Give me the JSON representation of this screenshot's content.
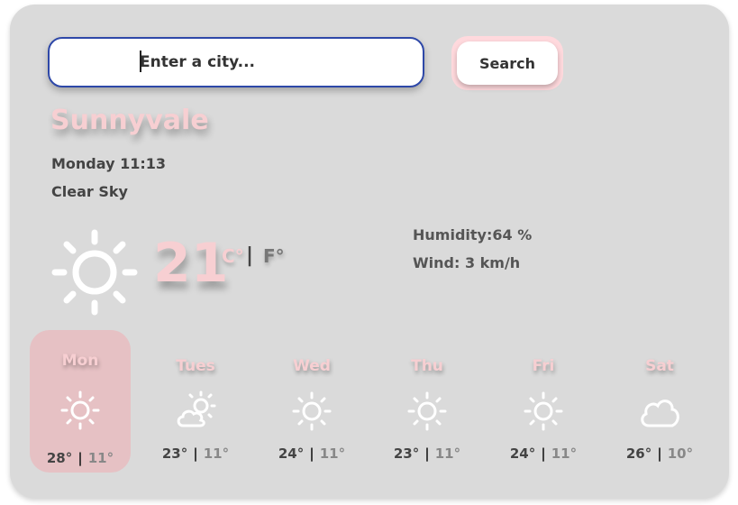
{
  "search": {
    "placeholder": "Enter a city...",
    "button_label": "Search"
  },
  "current": {
    "city": "Sunnyvale",
    "datetime": "Monday 11:13",
    "condition": "Clear Sky",
    "temperature": "21",
    "unit_celsius": "C°",
    "unit_separator": "|",
    "unit_fahrenheit": "F°",
    "humidity": "Humidity:64 %",
    "wind": "Wind: 3 km/h",
    "icon": "sun-icon"
  },
  "forecast": [
    {
      "day": "Mon",
      "max": "28°",
      "min": "11°",
      "icon": "sun-icon",
      "active": true
    },
    {
      "day": "Tues",
      "max": "23°",
      "min": "11°",
      "icon": "partly-cloudy-icon",
      "active": false
    },
    {
      "day": "Wed",
      "max": "24°",
      "min": "11°",
      "icon": "sun-icon",
      "active": false
    },
    {
      "day": "Thu",
      "max": "23°",
      "min": "11°",
      "icon": "sun-icon",
      "active": false
    },
    {
      "day": "Fri",
      "max": "24°",
      "min": "11°",
      "icon": "sun-icon",
      "active": false
    },
    {
      "day": "Sat",
      "max": "26°",
      "min": "10°",
      "icon": "cloud-icon",
      "active": false
    }
  ],
  "separator": "|",
  "colors": {
    "card_background": "#dadada",
    "accent_pink": "#f7cfd2",
    "active_day": "#e6c1c4",
    "input_border": "#2e48a8"
  }
}
